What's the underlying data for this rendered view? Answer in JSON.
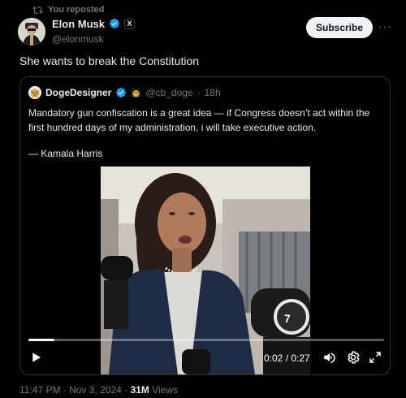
{
  "repost": {
    "label": "You reposted"
  },
  "author": {
    "name": "Elon Musk",
    "handle": "@elonmusk",
    "badge_letter": "X"
  },
  "actions": {
    "subscribe_label": "Subscribe",
    "more_label": "···"
  },
  "tweet": {
    "text": "She wants to break the Constitution"
  },
  "quote": {
    "name": "DogeDesigner",
    "handle": "@cb_doge",
    "separator": "·",
    "time": "18h",
    "text": "Mandatory gun confiscation is a great idea — if Congress doesn’t act within the first hundred days of my administration, i will take executive action.",
    "signature": "— Kamala Harris"
  },
  "video": {
    "time_display": "0:02 / 0:27",
    "progress_fraction": 0.074
  },
  "meta": {
    "timestamp": "11:47 PM · Nov 3, 2024 · ",
    "views_count": "31M",
    "views_label": " Views"
  },
  "colors": {
    "verified_blue": "#1d9bf0",
    "text_secondary": "#71767b",
    "border": "#2f3336"
  },
  "icons": {
    "repost": "repost-icon",
    "verified": "verified-badge-icon",
    "play": "play-icon",
    "volume": "volume-icon",
    "settings": "gear-icon",
    "fullscreen": "fullscreen-icon"
  }
}
